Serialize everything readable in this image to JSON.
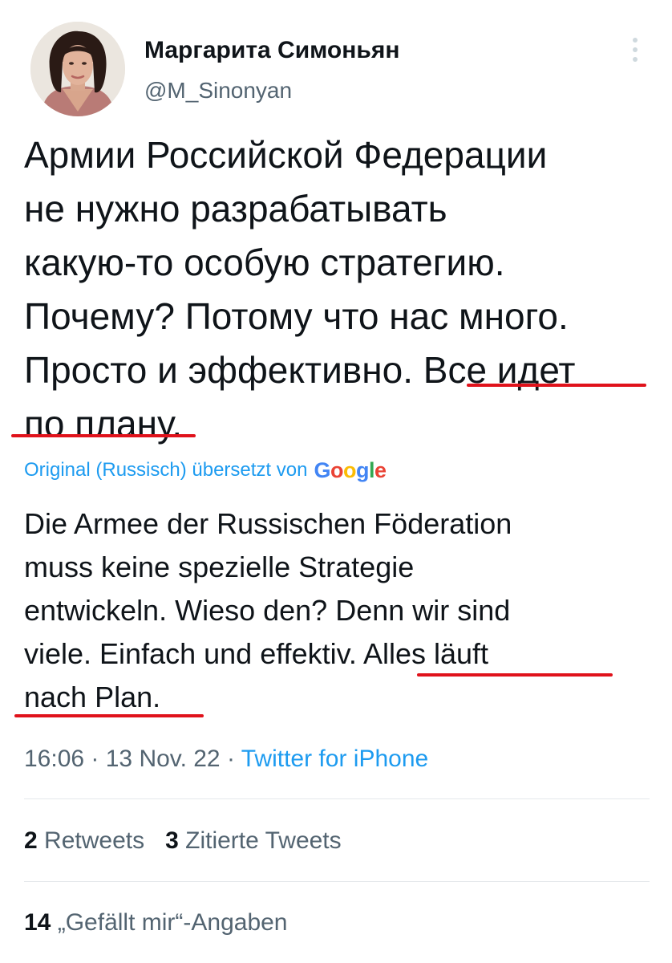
{
  "author": {
    "display_name": "Маргарита Симоньян",
    "handle": "@M_Sinonyan"
  },
  "tweet": {
    "lines": [
      "Армии Российской Федерации",
      "не нужно разрабатывать",
      "какую-то особую стратегию.",
      "Почему? Потому что нас много.",
      "Просто и эффективно.",
      "Все идет",
      "по плану",
      "."
    ]
  },
  "translation": {
    "label": "Original (Russisch) übersetzt von",
    "provider": "Google",
    "lines": [
      "Die Armee der Russischen Föderation",
      "muss keine spezielle Strategie",
      "entwickeln. Wieso den? Denn wir sind",
      "viele. Einfach und effektiv.",
      "Alles läuft",
      "nach Plan."
    ]
  },
  "meta": {
    "time": "16:06",
    "separator": " · ",
    "date": "13 Nov. 22",
    "source": "Twitter for iPhone"
  },
  "stats": {
    "retweets_count": "2",
    "retweets_label": "Retweets",
    "quotes_count": "3",
    "quotes_label": "Zitierte Tweets",
    "likes_count": "14",
    "likes_label": "„Gefällt mir“-Angaben"
  },
  "colors": {
    "link": "#1d9bf0",
    "secondary_text": "#536471",
    "primary_text": "#0f1419",
    "annotation_underline": "#e0121b"
  },
  "icons": {
    "more": "more-vertical-icon"
  }
}
